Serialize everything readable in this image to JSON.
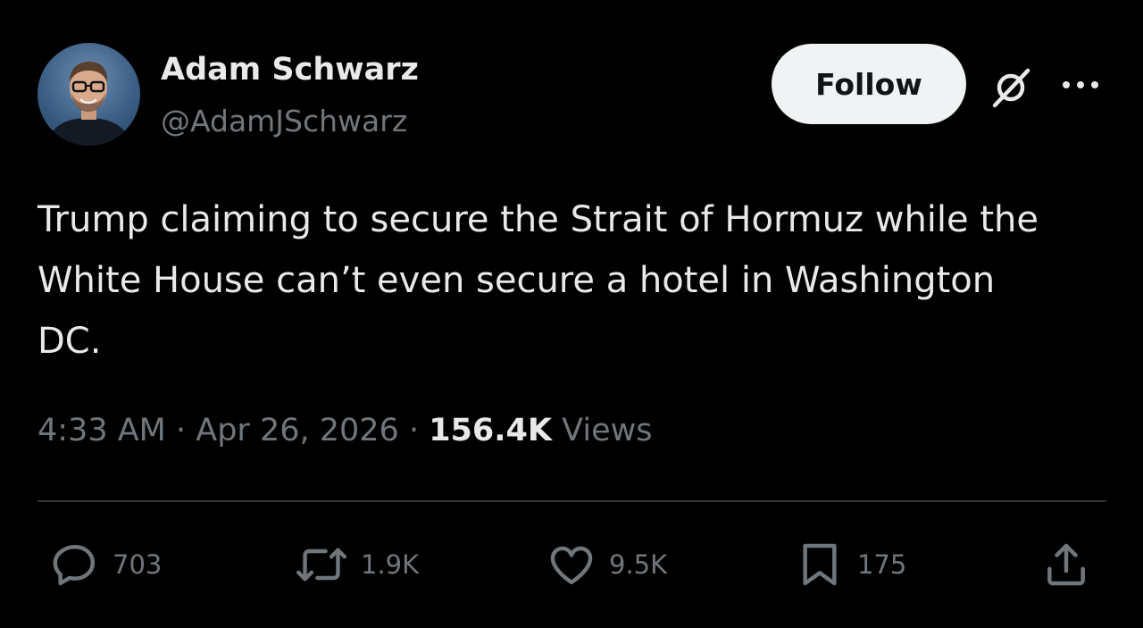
{
  "author": {
    "name": "Adam Schwarz",
    "handle": "@AdamJSchwarz"
  },
  "header": {
    "follow_label": "Follow"
  },
  "tweet": {
    "text": "Trump claiming to secure the Strait of Hormuz while the\nWhite House can’t even secure a hotel in Washington\nDC.",
    "time": "4:33 AM",
    "separator_1": " · ",
    "date": "Apr 26, 2026",
    "separator_2": " · ",
    "views_count": "156.4K",
    "views_label": " Views"
  },
  "actions": {
    "replies": "703",
    "reposts": "1.9K",
    "likes": "9.5K",
    "bookmarks": "175"
  },
  "colors": {
    "background": "#000000",
    "primary_text": "#e7e9ea",
    "secondary_text": "#71767b",
    "divider": "#2f3336",
    "follow_button_bg": "#eff3f4"
  },
  "icons": {
    "grok": "grok-icon",
    "more": "more-icon",
    "reply": "reply-icon",
    "repost": "repost-icon",
    "like": "heart-icon",
    "bookmark": "bookmark-icon",
    "share": "share-icon"
  }
}
